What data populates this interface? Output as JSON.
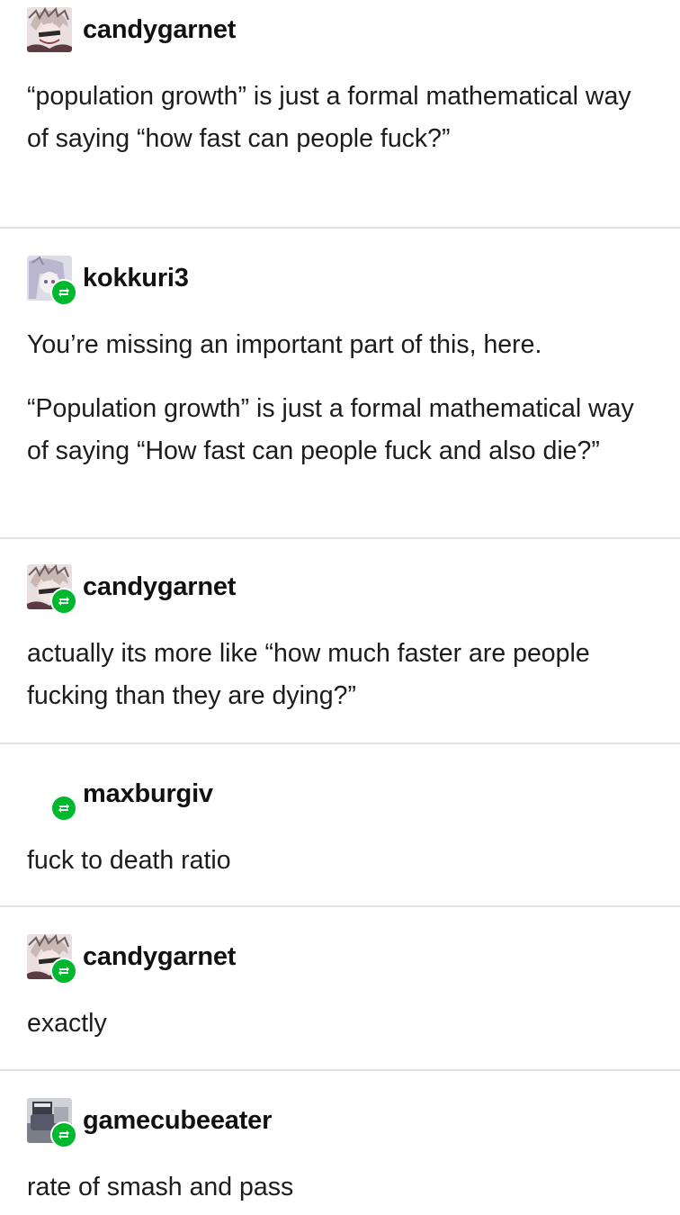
{
  "posts": [
    {
      "username": "candygarnet",
      "avatar_icon": "anime-avatar-icon",
      "reblog": false,
      "paragraphs": [
        "“population growth” is just a formal mathematical way of saying “how fast can people fuck?”"
      ]
    },
    {
      "username": "kokkuri3",
      "avatar_icon": "anime-avatar-icon",
      "reblog": true,
      "paragraphs": [
        "You’re missing an important part of this, here.",
        "“Population growth” is just a formal mathematical way of saying “How fast can people fuck and also die?”"
      ]
    },
    {
      "username": "candygarnet",
      "avatar_icon": "anime-avatar-icon",
      "reblog": true,
      "paragraphs": [
        "actually its more like “how much faster are people fucking than they are dying?”"
      ]
    },
    {
      "username": "maxburgiv",
      "avatar_icon": "none",
      "reblog": true,
      "paragraphs": [
        "fuck to death ratio"
      ]
    },
    {
      "username": "candygarnet",
      "avatar_icon": "anime-avatar-icon",
      "reblog": true,
      "paragraphs": [
        "exactly"
      ]
    },
    {
      "username": "gamecubeeater",
      "avatar_icon": "gamecube-avatar-icon",
      "reblog": true,
      "paragraphs": [
        "rate of smash and pass"
      ]
    }
  ],
  "colors": {
    "reblog_badge": "#00b82e",
    "divider": "#e2e2e2",
    "text": "#1c1c1c"
  }
}
